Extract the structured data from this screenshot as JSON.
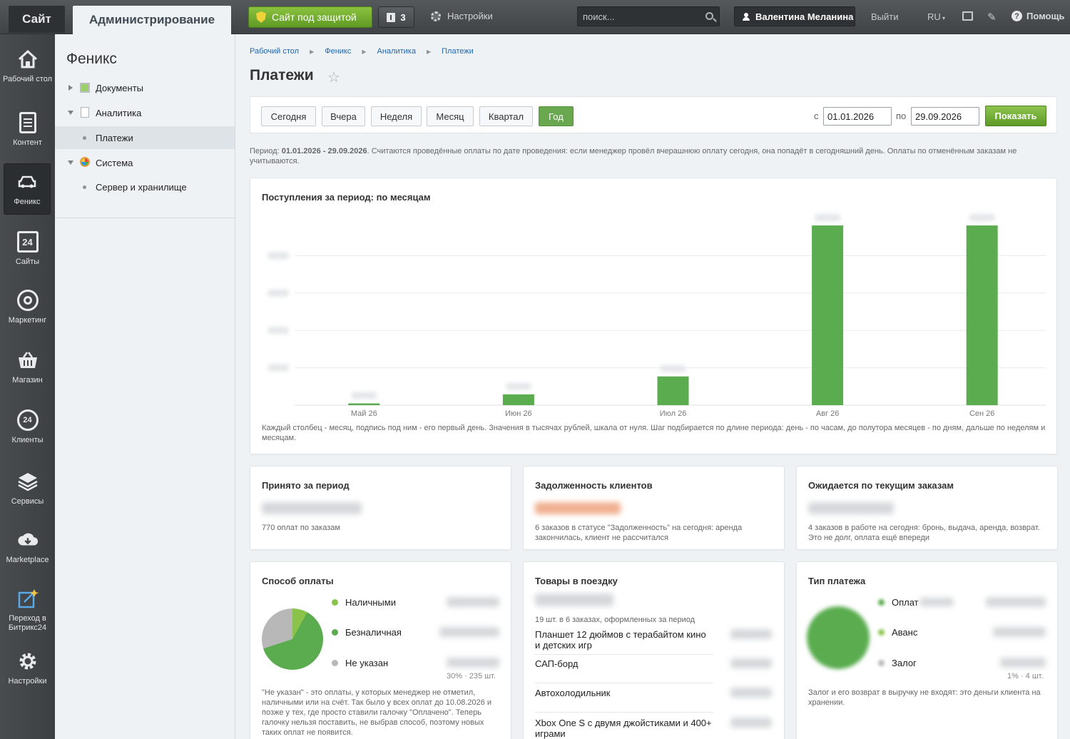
{
  "topbar": {
    "site_tab": "Сайт",
    "admin_tab": "Администрирование",
    "protect_label": "Сайт под защитой",
    "notif_count": "3",
    "settings_label": "Настройки",
    "search_placeholder": "поиск...",
    "user_name": "Валентина Меланина",
    "logout_label": "Выйти",
    "lang_label": "RU",
    "help_label": "Помощь"
  },
  "leftnav": [
    {
      "label": "Рабочий стол",
      "icon": "home-icon"
    },
    {
      "label": "Контент",
      "icon": "document-icon"
    },
    {
      "label": "Феникс",
      "icon": "car-icon",
      "active": true
    },
    {
      "label": "Сайты",
      "icon": "calendar-24-icon"
    },
    {
      "label": "Маркетинг",
      "icon": "target-icon"
    },
    {
      "label": "Магазин",
      "icon": "basket-icon"
    },
    {
      "label": "Клиенты",
      "icon": "clients-24-icon"
    },
    {
      "label": "Сервисы",
      "icon": "layers-icon"
    },
    {
      "label": "Marketplace",
      "icon": "cloud-download-icon"
    },
    {
      "label": "Переход в Битрикс24",
      "icon": "external-icon"
    },
    {
      "label": "Настройки",
      "icon": "gear-icon"
    }
  ],
  "tree": {
    "title": "Феникс",
    "items": [
      {
        "label": "Документы"
      },
      {
        "label": "Аналитика"
      },
      {
        "label": "Платежи"
      },
      {
        "label": "Система"
      },
      {
        "label": "Сервер и хранилище"
      }
    ]
  },
  "breadcrumb": [
    "Рабочий стол",
    "Феникс",
    "Аналитика",
    "Платежи"
  ],
  "page_title": "Платежи",
  "filter": {
    "periods": [
      "Сегодня",
      "Вчера",
      "Неделя",
      "Месяц",
      "Квартал",
      "Год"
    ],
    "active_period": "Год",
    "from_label": "с",
    "from_value": "01.01.2026",
    "to_label": "по",
    "to_value": "29.09.2026",
    "show_label": "Показать"
  },
  "period_note": {
    "prefix": "Период: ",
    "range": "01.01.2026 - 29.09.2026",
    "text": ". Считаются проведённые оплаты по дате проведения: если менеджер провёл вчерашнюю оплату сегодня, она попадёт в сегодняшний день. Оплаты по отменённым заказам не учитываются."
  },
  "chart_card": {
    "title": "Поступления за период: по месяцам",
    "note": "Каждый столбец - месяц, подпись под ним - его первый день. Значения в тысячах рублей, шкала от нуля. Шаг подбирается по длине периода: день - по часам, до полутора месяцев - по дням, дальше по неделям и месяцам."
  },
  "chart_data": {
    "type": "bar",
    "categories": [
      "Май 26",
      "Июн 26",
      "Июл 26",
      "Авг 26",
      "Сен 26"
    ],
    "values": [
      0.01,
      0.06,
      0.16,
      1.0,
      1.0
    ],
    "value_scale": "relative to tallest bar (exact values unreadable)",
    "ylim": [
      0,
      1.04
    ],
    "grid": true,
    "color": "#5aac4f"
  },
  "kpi": [
    {
      "title": "Принято за период",
      "note": "770 оплат по заказам"
    },
    {
      "title": "Задолженность клиентов",
      "note": "6 заказов в статусе \"Задолженность\" на сегодня: аренда закончилась, клиент не рассчитался"
    },
    {
      "title": "Ожидается по текущим заказам",
      "note": "4 заказов в работе на сегодня: бронь, выдача, аренда, возврат. Это не долг, оплата ещё впереди"
    }
  ],
  "payment_method": {
    "title": "Способ оплаты",
    "legend": [
      {
        "label": "Наличными",
        "color": "#8bc34a"
      },
      {
        "label": "Безналичная",
        "color": "#5aac4f"
      },
      {
        "label": "Не указан",
        "color": "#b8b8b8"
      }
    ],
    "pie_shares": [
      0.08,
      0.62,
      0.3
    ],
    "last_share_note": "30% · 235 шт.",
    "note": "\"Не указан\" - это оплаты, у которых менеджер не отметил, наличными или на счёт. Так было у всех оплат до 10.08.2026 и позже у тех, где просто ставили галочку \"Оплачено\". Теперь галочку нельзя поставить, не выбрав способ, поэтому новых таких оплат не появится."
  },
  "goods": {
    "title": "Товары в поездку",
    "subtitle": "19 шт. в 6 заказах, оформленных за период",
    "items": [
      "Планшет 12 дюймов с терабайтом кино и детских игр",
      "САП-борд",
      "Автохолодильник",
      "Xbox One S с двумя джойстиками и 400+ играми"
    ]
  },
  "payment_type": {
    "title": "Тип платежа",
    "legend": [
      {
        "label": "Оплат",
        "color": "#5aac4f"
      },
      {
        "label": "Аванс",
        "color": "#8bc34a"
      },
      {
        "label": "Залог",
        "color": "#b8b8b8"
      }
    ],
    "last_share_note": "1% · 4 шт.",
    "note": "Залог и его возврат в выручку не входят: это деньги клиента на хранении."
  }
}
